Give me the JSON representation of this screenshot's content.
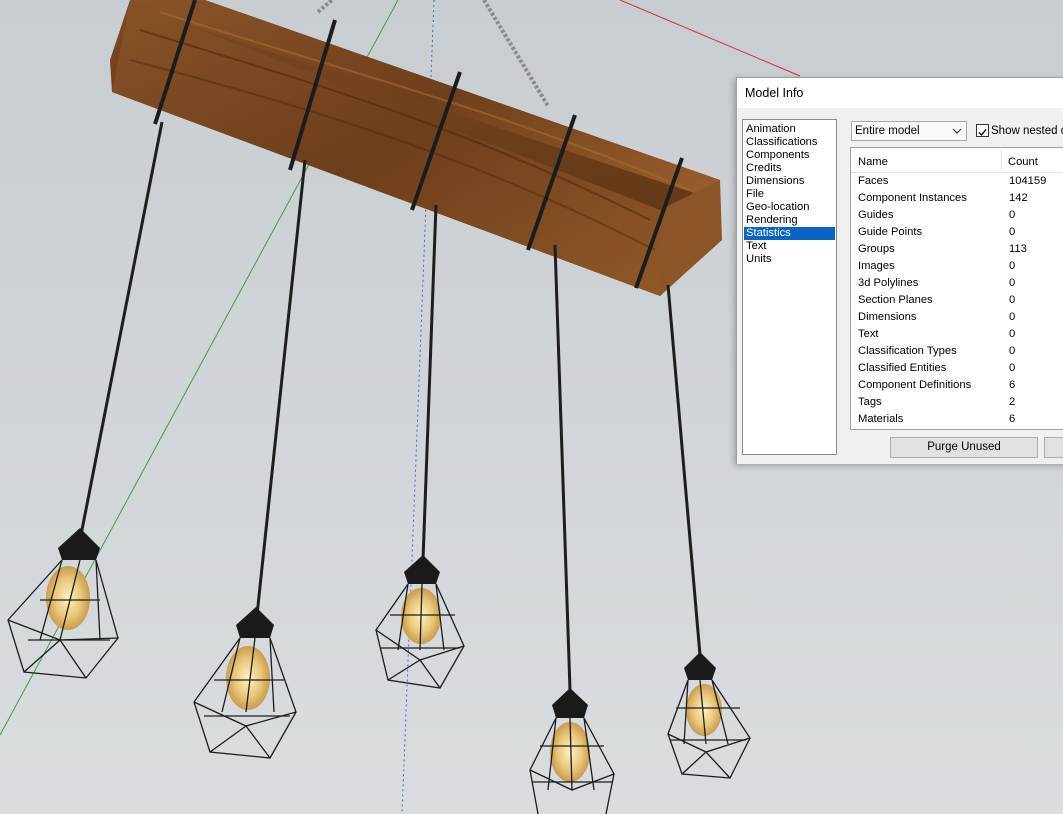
{
  "dialog": {
    "title": "Model Info",
    "sidebar": [
      {
        "label": "Animation",
        "selected": false
      },
      {
        "label": "Classifications",
        "selected": false
      },
      {
        "label": "Components",
        "selected": false
      },
      {
        "label": "Credits",
        "selected": false
      },
      {
        "label": "Dimensions",
        "selected": false
      },
      {
        "label": "File",
        "selected": false
      },
      {
        "label": "Geo-location",
        "selected": false
      },
      {
        "label": "Rendering",
        "selected": false
      },
      {
        "label": "Statistics",
        "selected": true
      },
      {
        "label": "Text",
        "selected": false
      },
      {
        "label": "Units",
        "selected": false
      }
    ],
    "scope": {
      "value": "Entire model",
      "icon": "chevron-down-icon"
    },
    "show_nested": {
      "label": "Show nested co",
      "checked": true
    },
    "table": {
      "headers": {
        "name": "Name",
        "count": "Count"
      },
      "rows": [
        {
          "name": "Faces",
          "count": "104159"
        },
        {
          "name": "Component Instances",
          "count": "142"
        },
        {
          "name": "Guides",
          "count": "0"
        },
        {
          "name": "Guide Points",
          "count": "0"
        },
        {
          "name": "Groups",
          "count": "113"
        },
        {
          "name": "Images",
          "count": "0"
        },
        {
          "name": "3d Polylines",
          "count": "0"
        },
        {
          "name": "Section Planes",
          "count": "0"
        },
        {
          "name": "Dimensions",
          "count": "0"
        },
        {
          "name": "Text",
          "count": "0"
        },
        {
          "name": "Classification Types",
          "count": "0"
        },
        {
          "name": "Classified Entities",
          "count": "0"
        },
        {
          "name": "Component Definitions",
          "count": "6"
        },
        {
          "name": "Tags",
          "count": "2"
        },
        {
          "name": "Materials",
          "count": "6"
        }
      ]
    },
    "purge_button": "Purge Unused"
  },
  "colors": {
    "sky": "#cfd4d9",
    "wood": "#7a4a22",
    "cord": "#1e1e1e",
    "bulb": "#e8c070",
    "selection": "#0a64c8"
  }
}
